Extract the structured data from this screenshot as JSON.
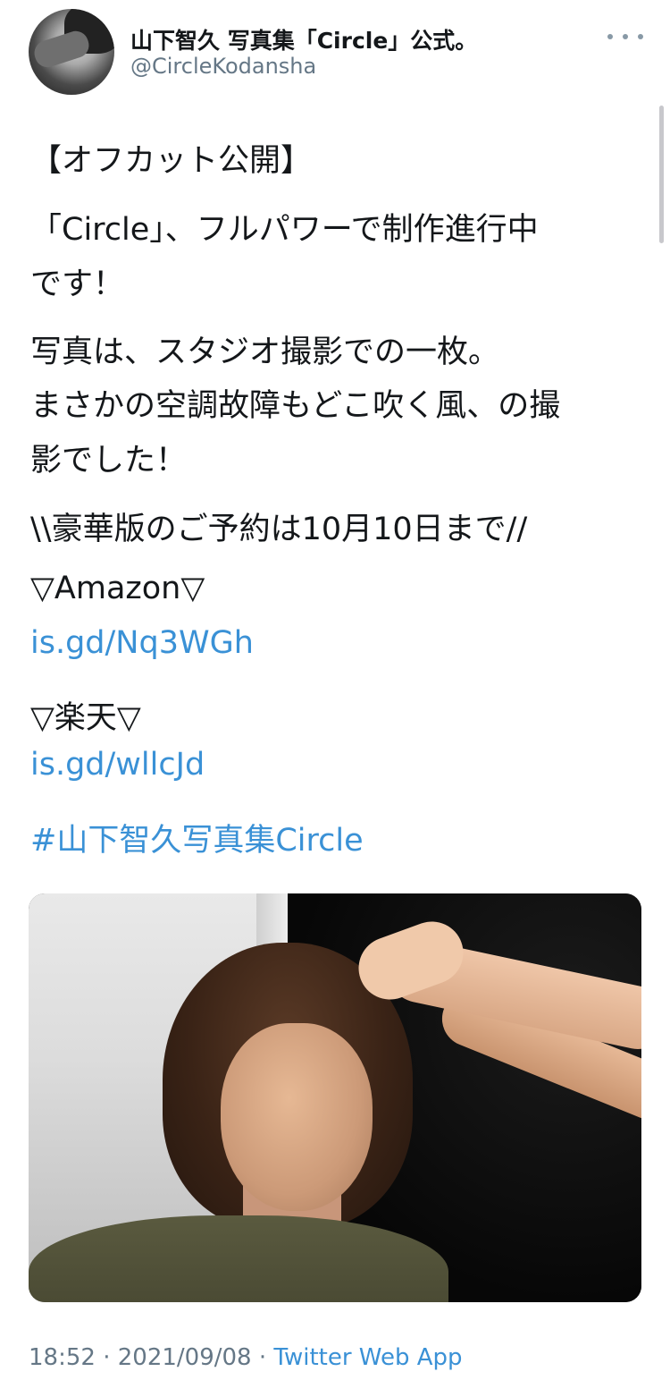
{
  "header": {
    "display_name": "山下智久 写真集「Circle」公式。",
    "handle": "@CircleKodansha"
  },
  "tweet": {
    "lines": [
      "【オフカット公開】",
      "「Circle」、フルパワーで制作進行中",
      "です！",
      "写真は、スタジオ撮影での一枚。",
      "まさかの空調故障もどこ吹く風、の撮",
      "影でした！",
      "\\\\豪華版のご予約は10月10日まで//",
      "▽Amazon▽",
      "is.gd/Nq3WGh",
      "▽楽天▽",
      "is.gd/wllcJd",
      "#山下智久写真集Circle"
    ]
  },
  "meta": {
    "time": "18:52",
    "separator": " · ",
    "date": "2021/09/08",
    "app": "Twitter Web App"
  },
  "colors": {
    "link": "#3a91d6",
    "secondary_text": "#657786",
    "primary_text": "#14171a"
  },
  "icons": {
    "more": "more-dots-icon"
  }
}
